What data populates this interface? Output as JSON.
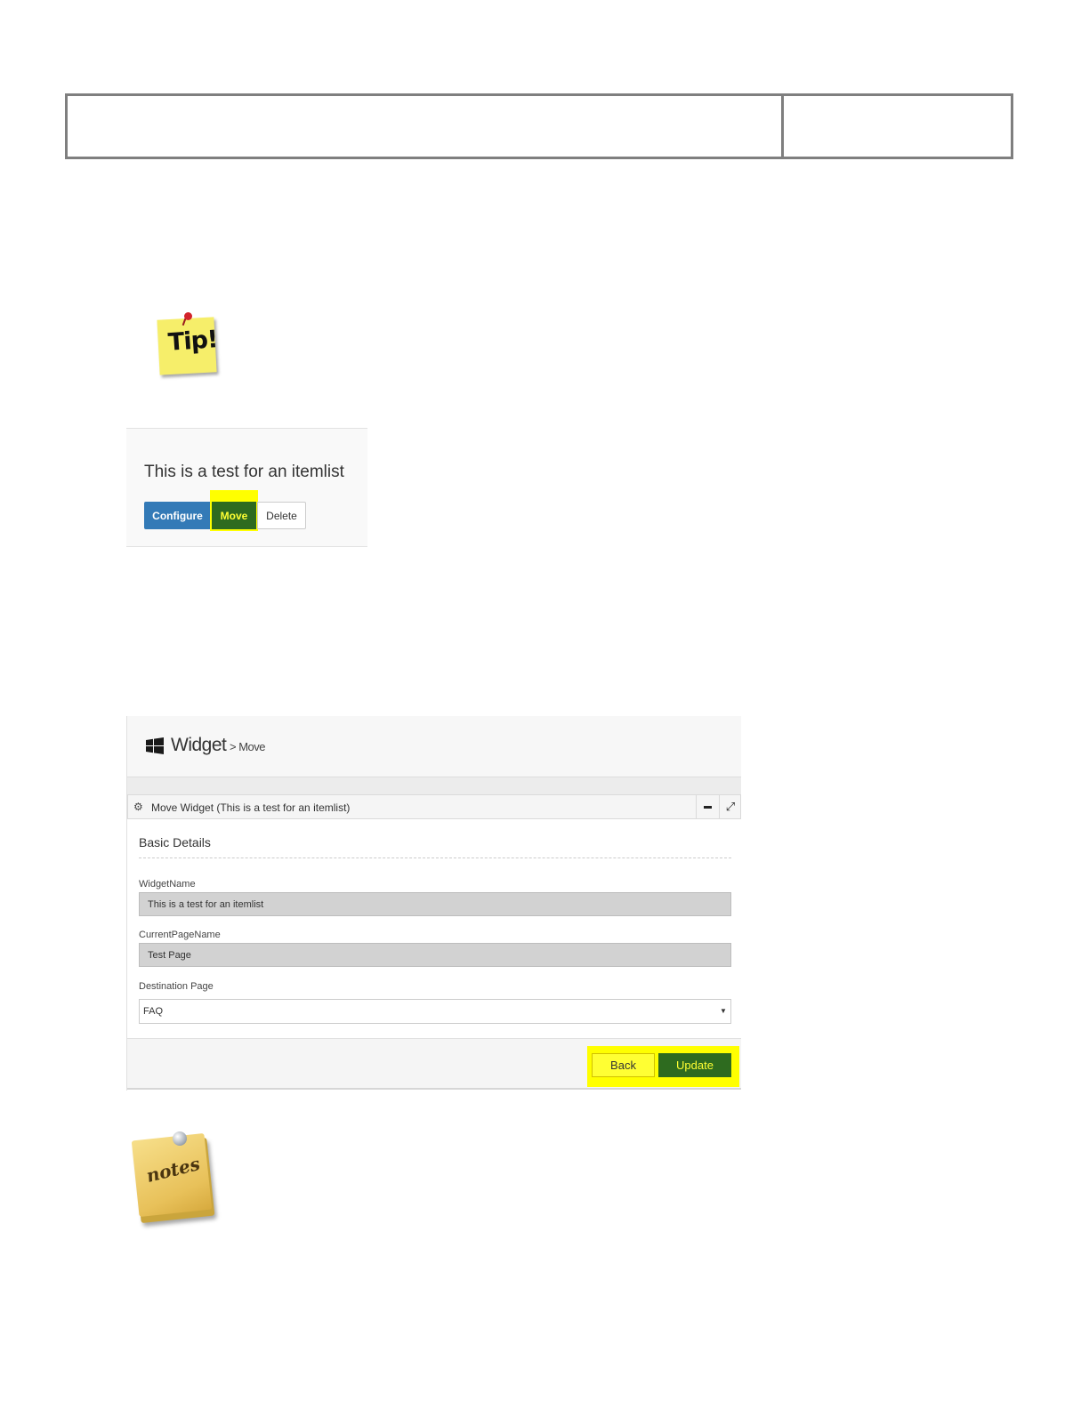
{
  "tip_label": "Tip!",
  "widget_card": {
    "title": "This is a test for an itemlist",
    "buttons": {
      "configure": "Configure",
      "move": "Move",
      "delete": "Delete"
    }
  },
  "move_page": {
    "title": "Widget",
    "breadcrumb": "> Move",
    "panel_title": "Move Widget (This is a test for an itemlist)",
    "section_title": "Basic Details",
    "fields": {
      "widget_name": {
        "label": "WidgetName",
        "value": "This is a test for an itemlist"
      },
      "current_page_name": {
        "label": "CurrentPageName",
        "value": "Test Page"
      },
      "destination_page": {
        "label": "Destination Page",
        "selected": "FAQ"
      }
    },
    "buttons": {
      "back": "Back",
      "update": "Update"
    }
  },
  "notes_label": "notes",
  "colors": {
    "highlight": "#ffff00",
    "primary_blue": "#337ab7",
    "dark_green": "#2e6b1f",
    "header_border": "#7f7f7f"
  }
}
